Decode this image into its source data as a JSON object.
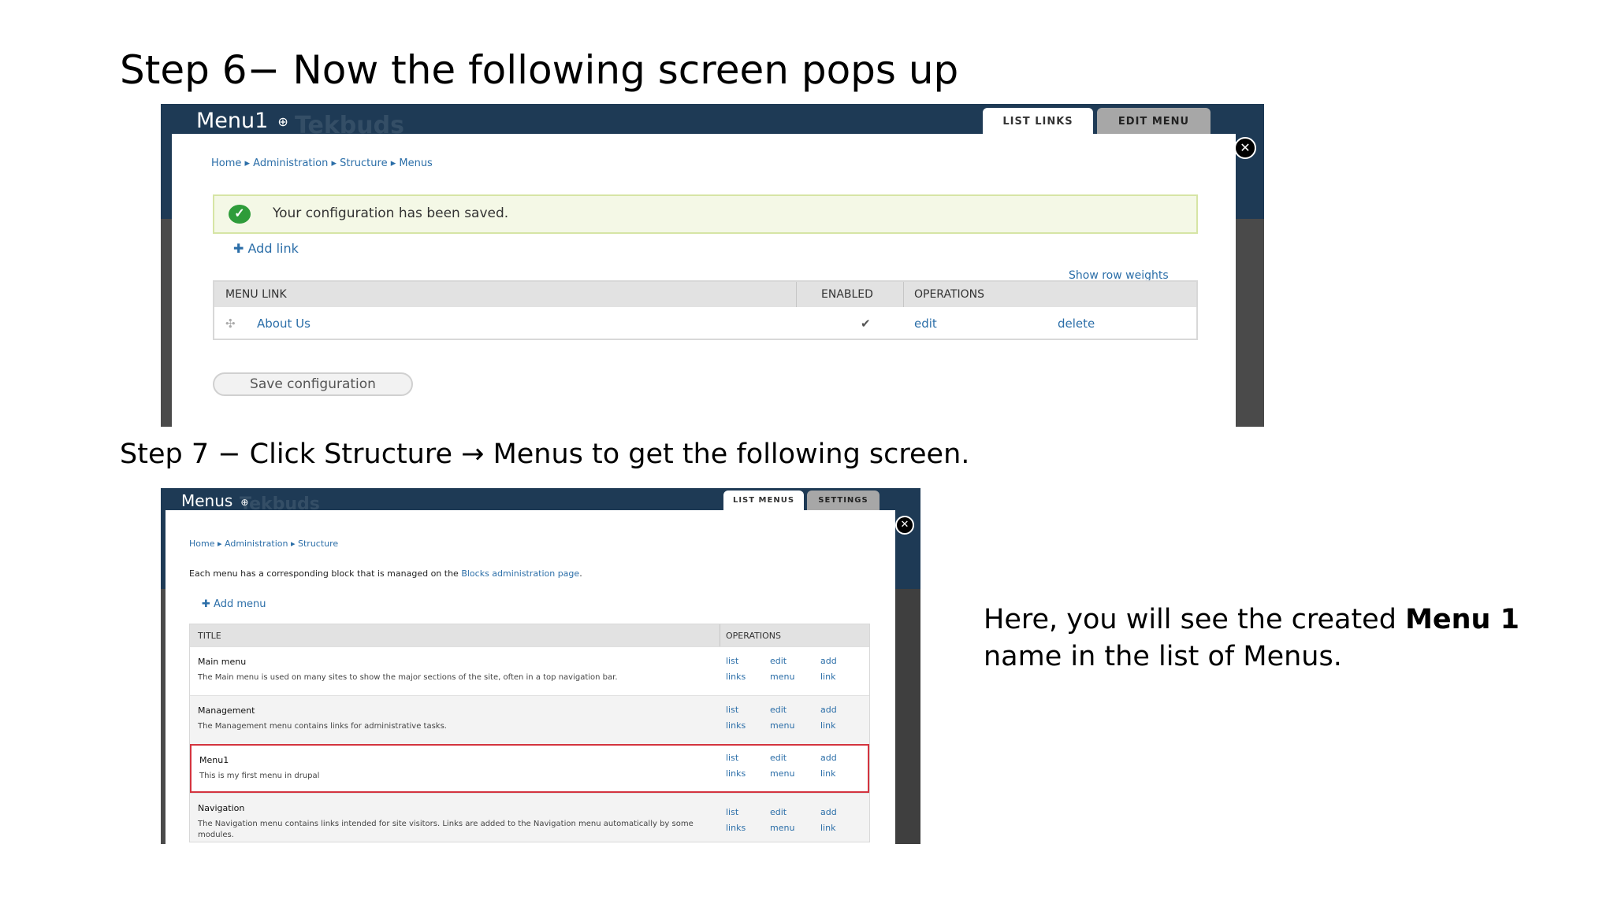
{
  "slide": {
    "title": "Step 6− Now the following screen pops up",
    "step7": "Step 7 − Click Structure → Menus to get the following screen.",
    "note_prefix": "Here, you will see the created ",
    "note_bold": "Menu 1",
    "note_suffix": " name in the list of Menus."
  },
  "screen1": {
    "overlay_title": "Menu1",
    "watermark": "Tekbuds",
    "tabs": [
      "LIST LINKS",
      "EDIT MENU"
    ],
    "breadcrumb": "Home ▸ Administration ▸ Structure ▸ Menus",
    "status_message": "Your configuration has been saved.",
    "add_link": "Add link",
    "show_row_weights": "Show row weights",
    "table": {
      "headers": [
        "MENU LINK",
        "ENABLED",
        "OPERATIONS"
      ],
      "rows": [
        {
          "link": "About Us",
          "enabled": "✔",
          "edit": "edit",
          "delete": "delete"
        }
      ]
    },
    "save_button": "Save configuration"
  },
  "screen2": {
    "overlay_title": "Menus",
    "watermark": "Tekbuds",
    "tabs": [
      "LIST MENUS",
      "SETTINGS"
    ],
    "breadcrumb": "Home ▸ Administration ▸ Structure",
    "info_prefix": "Each menu has a corresponding block that is managed on the ",
    "info_link": "Blocks administration page",
    "info_suffix": ".",
    "add_menu": "Add menu",
    "table": {
      "headers": [
        "TITLE",
        "OPERATIONS"
      ],
      "ops": {
        "list": "list",
        "links": "links",
        "edit": "edit",
        "menu": "menu",
        "add": "add",
        "link": "link"
      },
      "rows": [
        {
          "title": "Main menu",
          "desc": "The Main menu is used on many sites to show the major sections of the site, often in a top navigation bar."
        },
        {
          "title": "Management",
          "desc": "The Management menu contains links for administrative tasks."
        },
        {
          "title": "Menu1",
          "desc": "This is my first menu in drupal"
        },
        {
          "title": "Navigation",
          "desc": "The Navigation menu contains links intended for site visitors. Links are added to the Navigation menu automatically by some modules."
        }
      ]
    }
  },
  "colors": {
    "toolbar": "#1e3a55",
    "link": "#2b6ea8",
    "highlight": "#d4343f",
    "success": "#2e9c3a"
  }
}
